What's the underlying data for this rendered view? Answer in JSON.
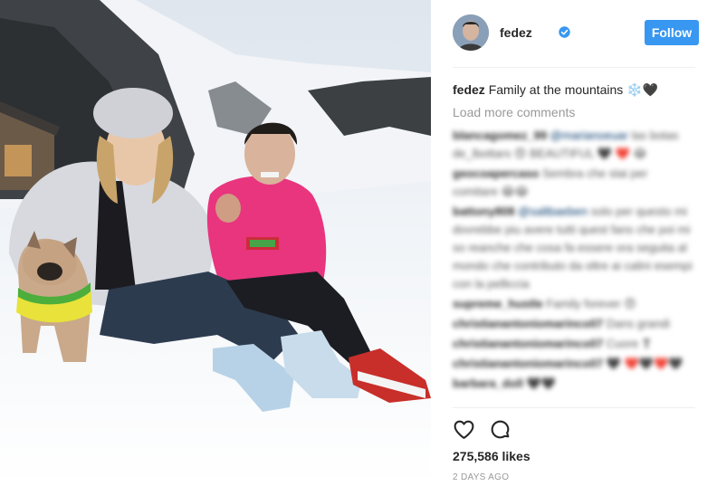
{
  "post": {
    "username": "fedez",
    "follow_label": "Follow",
    "caption_user": "fedez",
    "caption_text": "Family at the mountains ❄️🖤",
    "load_more_label": "Load more comments",
    "likes": "275,586 likes",
    "time": "2 DAYS AGO"
  },
  "comments": [
    {
      "user": "blancagomez_99",
      "mention": "@marianoeuar",
      "text": "las botas de_lbottars 😍 BEAUTIFUL 🖤 ❤️ 😂"
    },
    {
      "user": "geocoapercaso",
      "mention": "",
      "text": "Sembra che stai per comitare 😂😂"
    },
    {
      "user": "battony808",
      "mention": "@saltbaeben",
      "text": "solo per questo mi dovrebbe piu avere tutti quest fans che poi mi so reanche che cosa fa essere ora seguita al mondo che contributo da oltre ai calini esempi con la pelliccia"
    },
    {
      "user": "supreme_hustle",
      "mention": "",
      "text": "Family forever 😍"
    },
    {
      "user": "christianantoniomarinco07",
      "mention": "",
      "text": "Dans grandi"
    },
    {
      "user": "christianantoniomarinco07",
      "mention": "",
      "text": "Cuore ❣"
    },
    {
      "user": "christianantoniomarinco07",
      "mention": "",
      "text": "🖤 ❤️🖤❤️🖤"
    },
    {
      "user": "barbara_doll",
      "mention": "",
      "text": "🖤🖤"
    }
  ],
  "icons": {
    "verified": "verified-badge-icon",
    "like": "heart-icon",
    "comment": "speech-bubble-icon"
  },
  "colors": {
    "accent": "#3897f0",
    "muted": "#999999",
    "text": "#262626",
    "hoodie": "#e8357e"
  }
}
